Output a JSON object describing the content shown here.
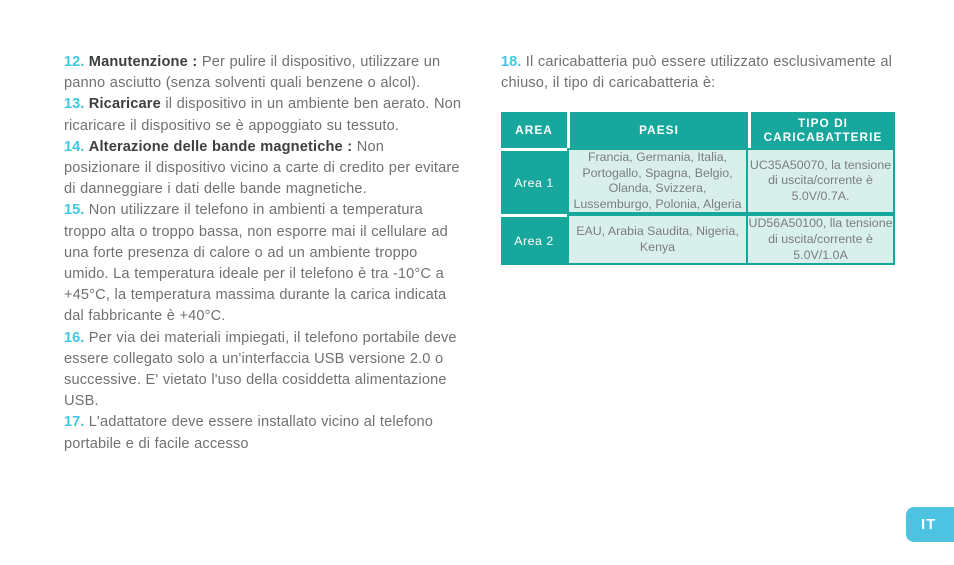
{
  "colors": {
    "accent_cyan": "#3fc8e4",
    "table_teal": "#18a79c",
    "table_body_bg": "#d9f0ea",
    "body_text": "#6f7173",
    "bold_text": "#3c3f41",
    "lang_tab": "#4cc3e0",
    "page_bg": "#ffffff"
  },
  "left_column": {
    "items": [
      {
        "number": "12.",
        "lead": "Manutenzione :",
        "text": " Per pulire il dispositivo, utilizzare un panno asciutto (senza solventi quali benzene o alcol)."
      },
      {
        "number": "13.",
        "lead": "Ricaricare",
        "text": " il dispositivo in un ambiente ben aerato. Non ricaricare il dispositivo se è appoggiato su tessuto."
      },
      {
        "number": "14.",
        "lead": "Alterazione delle bande magnetiche :",
        "text": " Non posizionare il dispositivo vicino a carte di credito per evitare di danneggiare i dati delle bande magnetiche."
      },
      {
        "number": "15.",
        "lead": "",
        "text": " Non utilizzare il telefono in ambienti a temperatura troppo alta o troppo bassa, non esporre mai il cellulare ad una forte presenza di calore o ad un ambiente troppo umido.  La temperatura ideale per il telefono è tra -10°C a +45°C, la temperatura massima durante la carica indicata dal fabbricante è  +40°C."
      },
      {
        "number": "16.",
        "lead": "",
        "text": " Per via dei materiali impiegati, il telefono portabile deve essere collegato solo a un'interfaccia USB versione 2.0 o successive. E' vietato l'uso della cosiddetta alimentazione USB."
      },
      {
        "number": "17.",
        "lead": "",
        "text": " L'adattatore deve essere installato vicino al telefono portabile e di facile accesso"
      }
    ]
  },
  "right_column": {
    "items": [
      {
        "number": "18.",
        "lead": "",
        "text": " Il caricabatteria può essere utilizzato esclusivamente al chiuso, il tipo di caricabatteria è:"
      }
    ]
  },
  "table": {
    "headers": [
      "AREA",
      "PAESI",
      "TIPO DI CARICABATTERIE"
    ],
    "header_tipo_line1": "TIPO DI",
    "header_tipo_line2": "CARICABATTERIE",
    "rows": [
      {
        "area": "Area 1",
        "paesi": "Francia, Germania, Italia, Portogallo, Spagna, Belgio, Olanda, Svizzera, Lussemburgo, Polonia, Algeria",
        "tipo": "UC35A50070, la tensione di uscita/corrente è 5.0V/0.7A."
      },
      {
        "area": "Area 2",
        "paesi": "EAU, Arabia Saudita, Nigeria, Kenya",
        "tipo": "UD56A50100, lla tensione di uscita/corrente è 5.0V/1.0A"
      }
    ]
  },
  "language_tab": {
    "label": "IT"
  }
}
